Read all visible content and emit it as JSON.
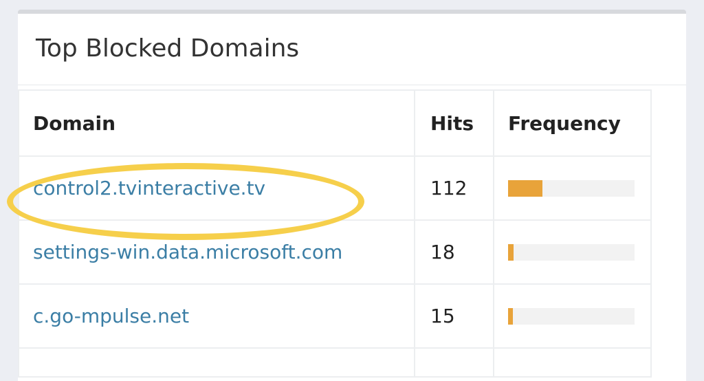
{
  "panel": {
    "title": "Top Blocked Domains"
  },
  "table": {
    "headers": {
      "domain": "Domain",
      "hits": "Hits",
      "frequency": "Frequency"
    },
    "rows": [
      {
        "domain": "control2.tvinteractive.tv",
        "hits": "112",
        "frequency": 0.27
      },
      {
        "domain": "settings-win.data.microsoft.com",
        "hits": "18",
        "frequency": 0.045
      },
      {
        "domain": "c.go-mpulse.net",
        "hits": "15",
        "frequency": 0.04
      }
    ]
  },
  "annotation": {
    "highlight_row": 0,
    "color": "#f6cf4b"
  },
  "colors": {
    "link": "#3b7ea5",
    "bar": "#e8a33a",
    "bar_track": "#f2f2f2"
  }
}
